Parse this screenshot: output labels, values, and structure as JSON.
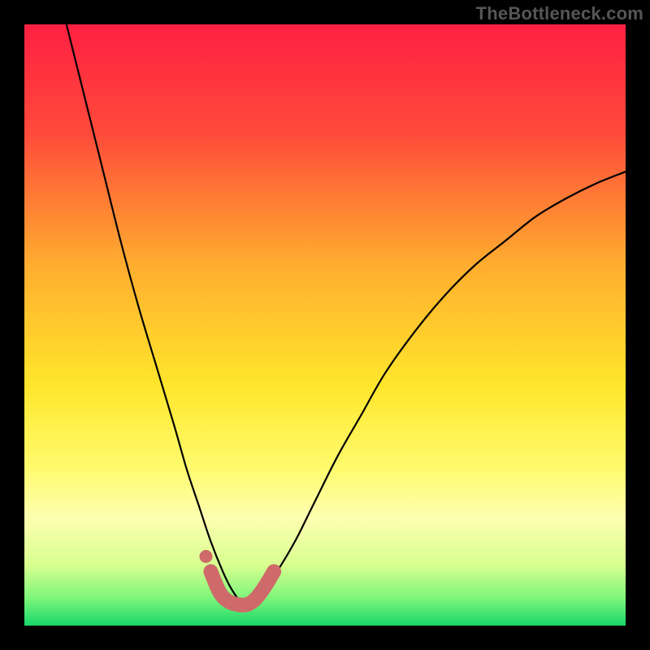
{
  "watermark": "TheBottleneck.com",
  "chart_data": {
    "type": "line",
    "title": "",
    "xlabel": "",
    "ylabel": "",
    "xlim": [
      0,
      100
    ],
    "ylim": [
      0,
      100
    ],
    "series": [
      {
        "name": "bottleneck-curve",
        "x": [
          7,
          10,
          13,
          16,
          19,
          22,
          25,
          27,
          29,
          31,
          33,
          34.5,
          36,
          37.5,
          39,
          42,
          45,
          48,
          52,
          56,
          60,
          65,
          70,
          75,
          80,
          85,
          90,
          95,
          100
        ],
        "y": [
          100,
          88,
          76,
          64,
          53,
          43,
          33,
          26,
          20,
          14,
          9,
          6,
          4,
          4,
          5,
          9,
          14,
          20,
          28,
          35,
          42,
          49,
          55,
          60,
          64,
          68,
          71,
          73.5,
          75.5
        ]
      },
      {
        "name": "highlight-segment",
        "x": [
          31,
          32.5,
          34,
          35.5,
          37,
          38.5,
          40,
          41.5
        ],
        "y": [
          9,
          5.5,
          4,
          3.5,
          3.5,
          4.5,
          6.5,
          9
        ]
      }
    ],
    "highlight_dot": {
      "x": 30.2,
      "y": 11.5
    },
    "gradient_stops": [
      {
        "offset": 0.0,
        "color": "#ff2043"
      },
      {
        "offset": 0.18,
        "color": "#ff4a3a"
      },
      {
        "offset": 0.4,
        "color": "#ffad2f"
      },
      {
        "offset": 0.6,
        "color": "#ffe62b"
      },
      {
        "offset": 0.74,
        "color": "#fffb6f"
      },
      {
        "offset": 0.82,
        "color": "#fdffb0"
      },
      {
        "offset": 0.9,
        "color": "#d7ff8f"
      },
      {
        "offset": 0.955,
        "color": "#7cf57a"
      },
      {
        "offset": 1.0,
        "color": "#17d76a"
      }
    ]
  }
}
